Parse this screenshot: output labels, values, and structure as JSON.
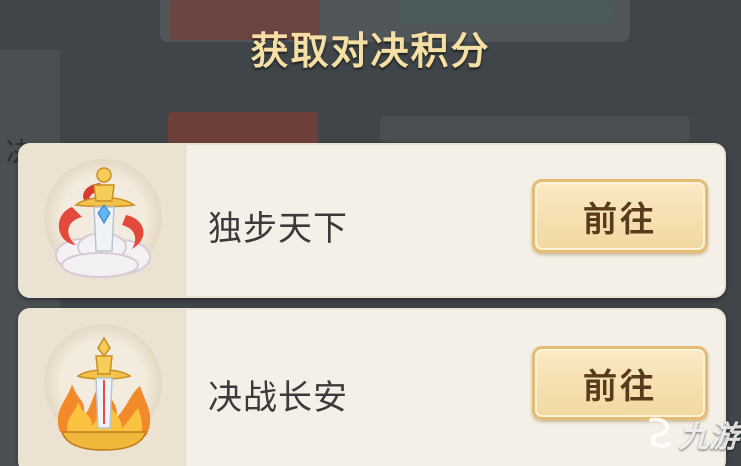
{
  "dialog": {
    "title": "获取对决积分"
  },
  "entries": [
    {
      "name": "独步天下",
      "button_label": "前往",
      "icon": "sword-on-cloud-icon"
    },
    {
      "name": "决战长安",
      "button_label": "前往",
      "icon": "sword-in-flames-icon"
    }
  ],
  "background": {
    "side_char": "决"
  },
  "watermark": {
    "text": "九游",
    "icon": "jiuyou-logo-icon"
  },
  "colors": {
    "title": "#f6dfa4",
    "card": "#f5f0e7",
    "button": "#f1d8a0",
    "button_border": "#e4bd72",
    "button_text": "#5a3a1c",
    "overlay": "#3f4548"
  }
}
